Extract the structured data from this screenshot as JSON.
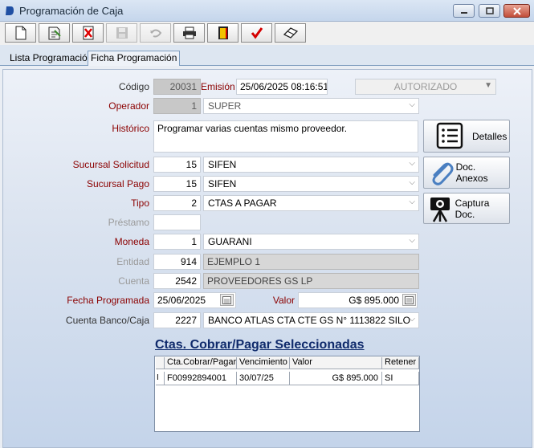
{
  "window": {
    "title": "Programación de Caja"
  },
  "toolbar": {
    "buttons": [
      "new-doc",
      "edit-doc",
      "delete-doc",
      "save-doc",
      "undo",
      "print",
      "exit",
      "confirm",
      "clear"
    ]
  },
  "tabs": {
    "lista": "Lista Programación",
    "ficha": "Ficha Programación"
  },
  "form": {
    "codigo_label": "Código",
    "codigo_value": "20031",
    "emision_label": "Emisión",
    "emision_value": "25/06/2025 08:16:51",
    "estado_value": "AUTORIZADO",
    "operador_label": "Operador",
    "operador_code": "1",
    "operador_name": "SUPER",
    "historico_label": "Histórico",
    "historico_value": "Programar varias cuentas mismo proveedor.",
    "sucursal_solicitud_label": "Sucursal Solicitud",
    "sucursal_solicitud_code": "15",
    "sucursal_solicitud_name": "SIFEN",
    "sucursal_pago_label": "Sucursal Pago",
    "sucursal_pago_code": "15",
    "sucursal_pago_name": "SIFEN",
    "tipo_label": "Tipo",
    "tipo_code": "2",
    "tipo_name": "CTAS A PAGAR",
    "prestamo_label": "Préstamo",
    "prestamo_value": "",
    "moneda_label": "Moneda",
    "moneda_code": "1",
    "moneda_name": "GUARANI",
    "entidad_label": "Entidad",
    "entidad_code": "914",
    "entidad_name": "EJEMPLO 1",
    "cuenta_label": "Cuenta",
    "cuenta_code": "2542",
    "cuenta_name": "PROVEEDORES GS LP",
    "fecha_programada_label": "Fecha Programada",
    "fecha_programada_value": "25/06/2025",
    "valor_label": "Valor",
    "valor_value": "G$ 895.000",
    "cuenta_banco_label": "Cuenta Banco/Caja",
    "cuenta_banco_code": "2227",
    "cuenta_banco_name": "BANCO ATLAS CTA CTE GS N° 1113822 SILO"
  },
  "side_buttons": {
    "detalles": "Detalles",
    "anexos": "Doc. Anexos",
    "captura": "Captura Doc."
  },
  "grid": {
    "title": "Ctas. Cobrar/Pagar Seleccionadas",
    "headers": [
      "Cta.Cobrar/Pagar",
      "Vencimiento",
      "Valor",
      "Retener"
    ],
    "rows": [
      {
        "indicator": "I",
        "cuenta": "F00992894001",
        "vencimiento": "30/07/25",
        "valor": "G$ 895.000",
        "retener": "SI"
      }
    ]
  },
  "colors": {
    "required_label": "#8b0000",
    "disabled_label": "#9a9a9a",
    "accent_title": "#0f2a6b"
  }
}
